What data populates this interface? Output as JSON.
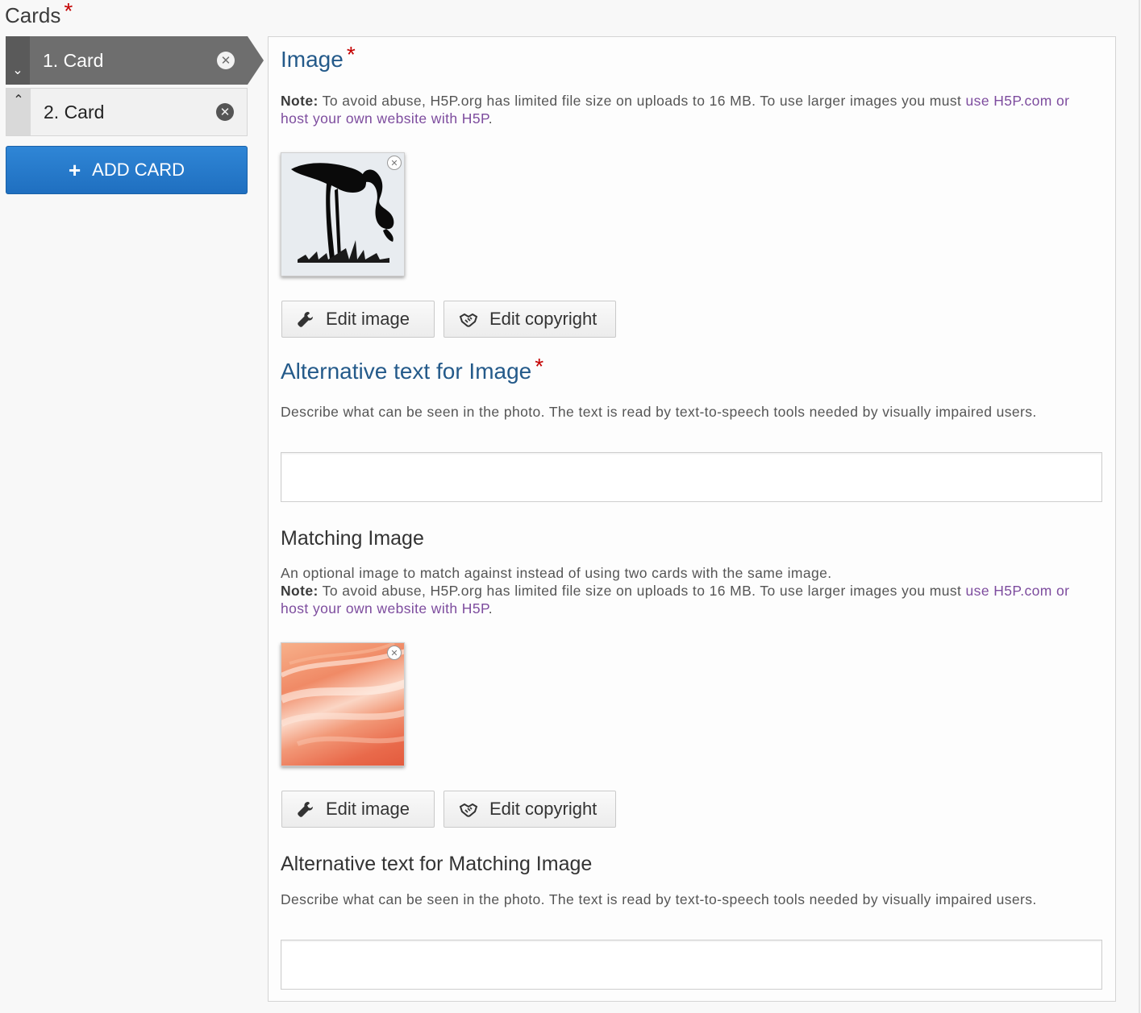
{
  "cards_header": {
    "label": "Cards",
    "required_mark": "*"
  },
  "cards": [
    {
      "label": "1. Card",
      "expand_glyph": "⌄",
      "remove_glyph": "✕"
    },
    {
      "label": "2. Card",
      "expand_glyph": "⌃",
      "remove_glyph": "✕"
    }
  ],
  "add_card": {
    "plus": "+",
    "label": "ADD CARD"
  },
  "image_section": {
    "title": "Image",
    "required_mark": "*",
    "note_bold": "Note:",
    "note_text": " To avoid abuse, H5P.org has limited file size on uploads to 16 MB. To use larger images you must ",
    "note_link": "use H5P.com or host your own website with H5P",
    "note_end": ".",
    "edit_image_label": "Edit image",
    "edit_copyright_label": "Edit copyright",
    "thumb_close": "✕"
  },
  "alt_text_section": {
    "title": "Alternative text for Image",
    "required_mark": "*",
    "description": "Describe what can be seen in the photo. The text is read by text-to-speech tools needed by visually impaired users.",
    "value": ""
  },
  "matching_image_section": {
    "title": "Matching Image",
    "description": "An optional image to match against instead of using two cards with the same image.",
    "note_bold": "Note:",
    "note_text": " To avoid abuse, H5P.org has limited file size on uploads to 16 MB. To use larger images you must ",
    "note_link": "use H5P.com or host your own website with H5P",
    "note_end": ".",
    "edit_image_label": "Edit image",
    "edit_copyright_label": "Edit copyright",
    "thumb_close": "✕"
  },
  "alt_matching_section": {
    "title": "Alternative text for Matching Image",
    "description": "Describe what can be seen in the photo. The text is read by text-to-speech tools needed by visually impaired users.",
    "value": ""
  },
  "colors": {
    "heading_blue": "#245a8a",
    "required_red": "#c40000",
    "link_purple": "#7d4c9e",
    "active_card": "#6e6e6e",
    "add_button": "#2f86d6"
  }
}
